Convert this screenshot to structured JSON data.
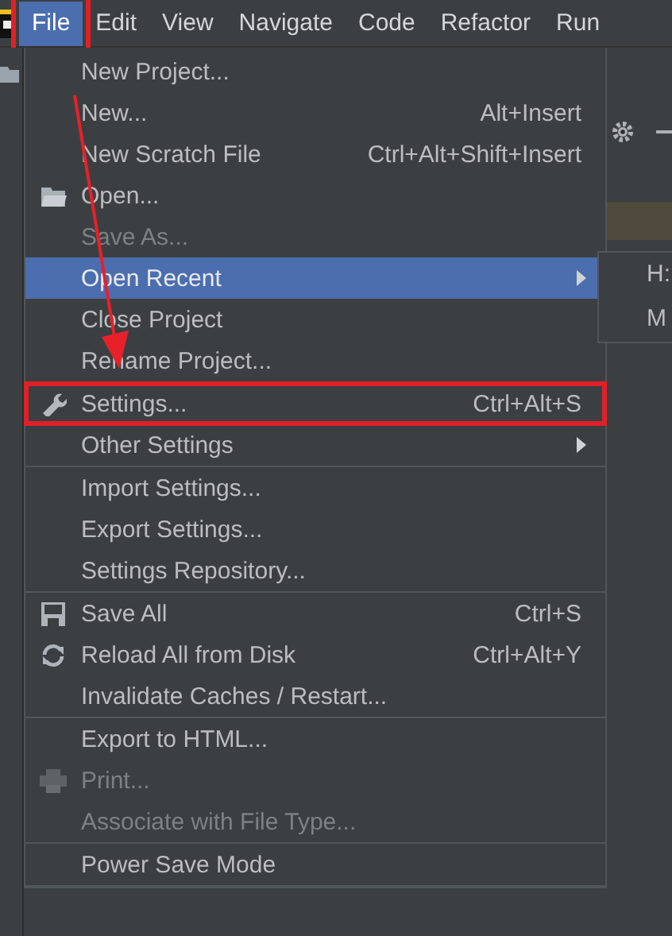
{
  "menubar": [
    {
      "label": "File",
      "selected": true,
      "annotated": true
    },
    {
      "label": "Edit",
      "selected": false,
      "annotated": false
    },
    {
      "label": "View",
      "selected": false,
      "annotated": false
    },
    {
      "label": "Navigate",
      "selected": false,
      "annotated": false
    },
    {
      "label": "Code",
      "selected": false,
      "annotated": false
    },
    {
      "label": "Refactor",
      "selected": false,
      "annotated": false
    },
    {
      "label": "Run",
      "selected": false,
      "annotated": false
    }
  ],
  "file_menu": [
    {
      "kind": "item",
      "label": "New Project...",
      "disabled": false,
      "selected": false,
      "annotated": false
    },
    {
      "kind": "item",
      "label": "New...",
      "shortcut": "Alt+Insert",
      "disabled": false,
      "selected": false,
      "annotated": false
    },
    {
      "kind": "item",
      "label": "New Scratch File",
      "shortcut": "Ctrl+Alt+Shift+Insert",
      "disabled": false,
      "selected": false,
      "annotated": false
    },
    {
      "kind": "item",
      "label": "Open...",
      "disabled": false,
      "selected": false,
      "annotated": false
    },
    {
      "kind": "item",
      "label": "Save As...",
      "disabled": true,
      "selected": false,
      "annotated": false
    },
    {
      "kind": "submenu",
      "label": "Open Recent",
      "disabled": false,
      "selected": true,
      "annotated": false
    },
    {
      "kind": "item",
      "label": "Close Project",
      "disabled": false,
      "selected": false,
      "annotated": false
    },
    {
      "kind": "item",
      "label": "Rename Project...",
      "disabled": false,
      "selected": false,
      "annotated": false
    },
    {
      "kind": "separator"
    },
    {
      "kind": "item",
      "label": "Settings...",
      "shortcut": "Ctrl+Alt+S",
      "disabled": false,
      "selected": false,
      "annotated": true
    },
    {
      "kind": "submenu",
      "label": "Other Settings",
      "disabled": false,
      "selected": false,
      "annotated": false
    },
    {
      "kind": "separator"
    },
    {
      "kind": "item",
      "label": "Import Settings...",
      "disabled": false,
      "selected": false,
      "annotated": false
    },
    {
      "kind": "item",
      "label": "Export Settings...",
      "disabled": false,
      "selected": false,
      "annotated": false
    },
    {
      "kind": "item",
      "label": "Settings Repository...",
      "disabled": false,
      "selected": false,
      "annotated": false
    },
    {
      "kind": "separator"
    },
    {
      "kind": "item",
      "label": "Save All",
      "shortcut": "Ctrl+S",
      "disabled": false,
      "selected": false,
      "annotated": false
    },
    {
      "kind": "item",
      "label": "Reload All from Disk",
      "shortcut": "Ctrl+Alt+Y",
      "disabled": false,
      "selected": false,
      "annotated": false
    },
    {
      "kind": "item",
      "label": "Invalidate Caches / Restart...",
      "disabled": false,
      "selected": false,
      "annotated": false
    },
    {
      "kind": "separator"
    },
    {
      "kind": "item",
      "label": "Export to HTML...",
      "disabled": false,
      "selected": false,
      "annotated": false
    },
    {
      "kind": "item",
      "label": "Print...",
      "disabled": true,
      "selected": false,
      "annotated": false
    },
    {
      "kind": "item",
      "label": "Associate with File Type...",
      "disabled": true,
      "selected": false,
      "annotated": false
    },
    {
      "kind": "separator"
    },
    {
      "kind": "item",
      "label": "Power Save Mode",
      "disabled": false,
      "selected": false,
      "annotated": false
    },
    {
      "kind": "separator"
    }
  ],
  "recent_submenu": [
    {
      "label": "H:"
    },
    {
      "label": "M"
    }
  ],
  "annotations": [
    {
      "kind": "arrow"
    }
  ]
}
